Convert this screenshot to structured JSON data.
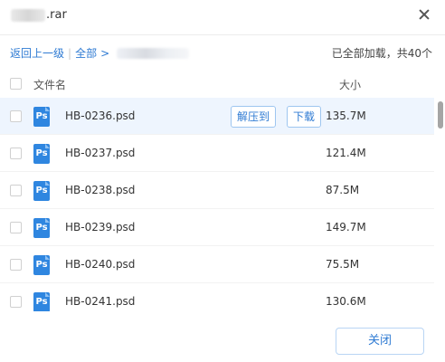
{
  "dialog": {
    "title_suffix": ".rar",
    "breadcrumb": {
      "back": "返回上一级",
      "separator": "|",
      "all": "全部",
      "arrow": ">"
    },
    "status": "已全部加载，共40个"
  },
  "columns": {
    "name": "文件名",
    "size": "大小"
  },
  "row_actions": {
    "extract": "解压到",
    "download": "下载"
  },
  "icon_label": "Ps",
  "files": [
    {
      "name": "HB-0236.psd",
      "size": "135.7M"
    },
    {
      "name": "HB-0237.psd",
      "size": "121.4M"
    },
    {
      "name": "HB-0238.psd",
      "size": "87.5M"
    },
    {
      "name": "HB-0239.psd",
      "size": "149.7M"
    },
    {
      "name": "HB-0240.psd",
      "size": "75.5M"
    },
    {
      "name": "HB-0241.psd",
      "size": "130.6M"
    }
  ],
  "footer": {
    "close": "关闭"
  },
  "colors": {
    "accent": "#2f7bd3",
    "ps_icon": "#2f86e0",
    "hover_row": "#eef5fe"
  }
}
